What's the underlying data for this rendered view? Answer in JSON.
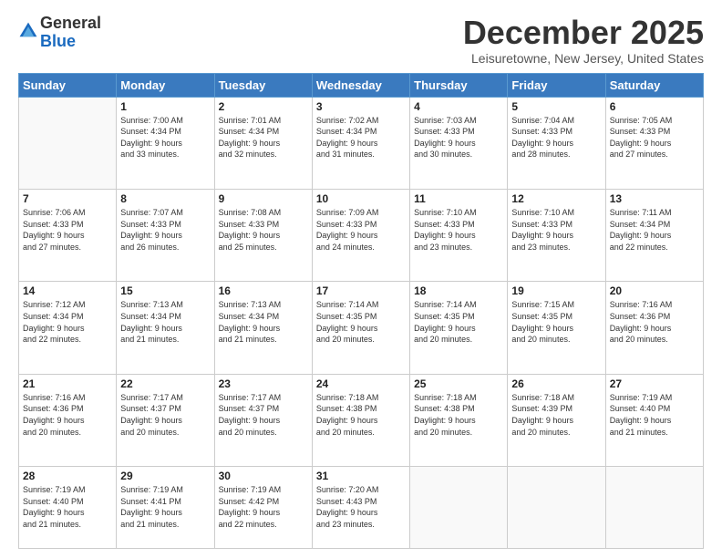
{
  "logo": {
    "general": "General",
    "blue": "Blue"
  },
  "header": {
    "month": "December 2025",
    "location": "Leisuretowne, New Jersey, United States"
  },
  "weekdays": [
    "Sunday",
    "Monday",
    "Tuesday",
    "Wednesday",
    "Thursday",
    "Friday",
    "Saturday"
  ],
  "weeks": [
    [
      {
        "day": "",
        "info": ""
      },
      {
        "day": "1",
        "info": "Sunrise: 7:00 AM\nSunset: 4:34 PM\nDaylight: 9 hours\nand 33 minutes."
      },
      {
        "day": "2",
        "info": "Sunrise: 7:01 AM\nSunset: 4:34 PM\nDaylight: 9 hours\nand 32 minutes."
      },
      {
        "day": "3",
        "info": "Sunrise: 7:02 AM\nSunset: 4:34 PM\nDaylight: 9 hours\nand 31 minutes."
      },
      {
        "day": "4",
        "info": "Sunrise: 7:03 AM\nSunset: 4:33 PM\nDaylight: 9 hours\nand 30 minutes."
      },
      {
        "day": "5",
        "info": "Sunrise: 7:04 AM\nSunset: 4:33 PM\nDaylight: 9 hours\nand 28 minutes."
      },
      {
        "day": "6",
        "info": "Sunrise: 7:05 AM\nSunset: 4:33 PM\nDaylight: 9 hours\nand 27 minutes."
      }
    ],
    [
      {
        "day": "7",
        "info": "Sunrise: 7:06 AM\nSunset: 4:33 PM\nDaylight: 9 hours\nand 27 minutes."
      },
      {
        "day": "8",
        "info": "Sunrise: 7:07 AM\nSunset: 4:33 PM\nDaylight: 9 hours\nand 26 minutes."
      },
      {
        "day": "9",
        "info": "Sunrise: 7:08 AM\nSunset: 4:33 PM\nDaylight: 9 hours\nand 25 minutes."
      },
      {
        "day": "10",
        "info": "Sunrise: 7:09 AM\nSunset: 4:33 PM\nDaylight: 9 hours\nand 24 minutes."
      },
      {
        "day": "11",
        "info": "Sunrise: 7:10 AM\nSunset: 4:33 PM\nDaylight: 9 hours\nand 23 minutes."
      },
      {
        "day": "12",
        "info": "Sunrise: 7:10 AM\nSunset: 4:33 PM\nDaylight: 9 hours\nand 23 minutes."
      },
      {
        "day": "13",
        "info": "Sunrise: 7:11 AM\nSunset: 4:34 PM\nDaylight: 9 hours\nand 22 minutes."
      }
    ],
    [
      {
        "day": "14",
        "info": "Sunrise: 7:12 AM\nSunset: 4:34 PM\nDaylight: 9 hours\nand 22 minutes."
      },
      {
        "day": "15",
        "info": "Sunrise: 7:13 AM\nSunset: 4:34 PM\nDaylight: 9 hours\nand 21 minutes."
      },
      {
        "day": "16",
        "info": "Sunrise: 7:13 AM\nSunset: 4:34 PM\nDaylight: 9 hours\nand 21 minutes."
      },
      {
        "day": "17",
        "info": "Sunrise: 7:14 AM\nSunset: 4:35 PM\nDaylight: 9 hours\nand 20 minutes."
      },
      {
        "day": "18",
        "info": "Sunrise: 7:14 AM\nSunset: 4:35 PM\nDaylight: 9 hours\nand 20 minutes."
      },
      {
        "day": "19",
        "info": "Sunrise: 7:15 AM\nSunset: 4:35 PM\nDaylight: 9 hours\nand 20 minutes."
      },
      {
        "day": "20",
        "info": "Sunrise: 7:16 AM\nSunset: 4:36 PM\nDaylight: 9 hours\nand 20 minutes."
      }
    ],
    [
      {
        "day": "21",
        "info": "Sunrise: 7:16 AM\nSunset: 4:36 PM\nDaylight: 9 hours\nand 20 minutes."
      },
      {
        "day": "22",
        "info": "Sunrise: 7:17 AM\nSunset: 4:37 PM\nDaylight: 9 hours\nand 20 minutes."
      },
      {
        "day": "23",
        "info": "Sunrise: 7:17 AM\nSunset: 4:37 PM\nDaylight: 9 hours\nand 20 minutes."
      },
      {
        "day": "24",
        "info": "Sunrise: 7:18 AM\nSunset: 4:38 PM\nDaylight: 9 hours\nand 20 minutes."
      },
      {
        "day": "25",
        "info": "Sunrise: 7:18 AM\nSunset: 4:38 PM\nDaylight: 9 hours\nand 20 minutes."
      },
      {
        "day": "26",
        "info": "Sunrise: 7:18 AM\nSunset: 4:39 PM\nDaylight: 9 hours\nand 20 minutes."
      },
      {
        "day": "27",
        "info": "Sunrise: 7:19 AM\nSunset: 4:40 PM\nDaylight: 9 hours\nand 21 minutes."
      }
    ],
    [
      {
        "day": "28",
        "info": "Sunrise: 7:19 AM\nSunset: 4:40 PM\nDaylight: 9 hours\nand 21 minutes."
      },
      {
        "day": "29",
        "info": "Sunrise: 7:19 AM\nSunset: 4:41 PM\nDaylight: 9 hours\nand 21 minutes."
      },
      {
        "day": "30",
        "info": "Sunrise: 7:19 AM\nSunset: 4:42 PM\nDaylight: 9 hours\nand 22 minutes."
      },
      {
        "day": "31",
        "info": "Sunrise: 7:20 AM\nSunset: 4:43 PM\nDaylight: 9 hours\nand 23 minutes."
      },
      {
        "day": "",
        "info": ""
      },
      {
        "day": "",
        "info": ""
      },
      {
        "day": "",
        "info": ""
      }
    ]
  ]
}
